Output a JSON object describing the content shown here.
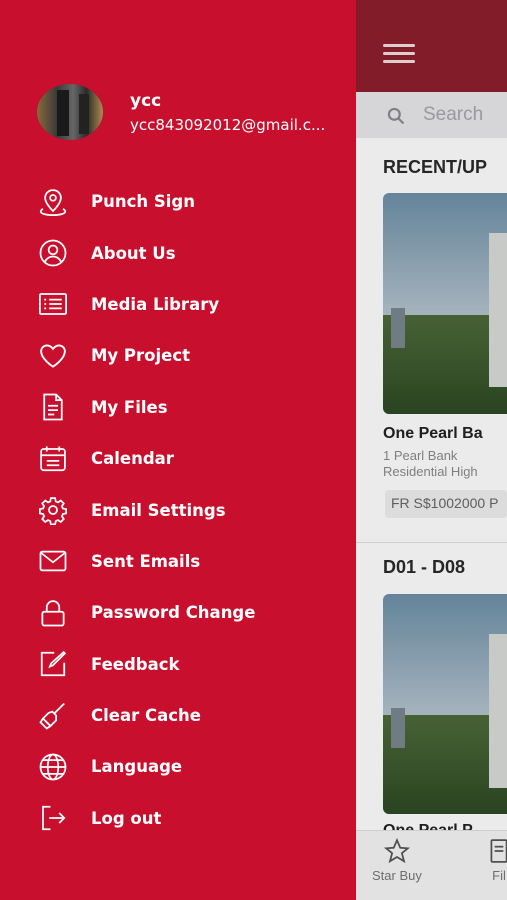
{
  "user": {
    "name": "ycc",
    "email": "ycc843092012@gmail.c..."
  },
  "menu": [
    {
      "label": "Punch Sign",
      "icon": "map-pin-icon"
    },
    {
      "label": "About Us",
      "icon": "user-circle-icon"
    },
    {
      "label": "Media Library",
      "icon": "media-list-icon"
    },
    {
      "label": "My Project",
      "icon": "heart-icon"
    },
    {
      "label": "My Files",
      "icon": "file-icon"
    },
    {
      "label": "Calendar",
      "icon": "calendar-icon"
    },
    {
      "label": "Email Settings",
      "icon": "gear-icon"
    },
    {
      "label": "Sent Emails",
      "icon": "envelope-icon"
    },
    {
      "label": "Password Change",
      "icon": "lock-icon"
    },
    {
      "label": "Feedback",
      "icon": "edit-icon"
    },
    {
      "label": "Clear Cache",
      "icon": "broom-icon"
    },
    {
      "label": "Language",
      "icon": "globe-icon"
    },
    {
      "label": "Log out",
      "icon": "logout-icon"
    }
  ],
  "background": {
    "search_placeholder": "Search",
    "section1_title": "RECENT/UP",
    "project_title": "One Pearl Ba",
    "project_address": "1 Pearl Bank",
    "project_type": "Residential High",
    "price": "FR S$1002000 P",
    "section2_title": "D01 - D08",
    "project2_title": "One Pearl P",
    "tab_star_buy": "Star Buy",
    "tab_other": "Fil"
  },
  "colors": {
    "drawer_red": "#c8102e",
    "topbar_dark_red": "#8e1f2c"
  }
}
